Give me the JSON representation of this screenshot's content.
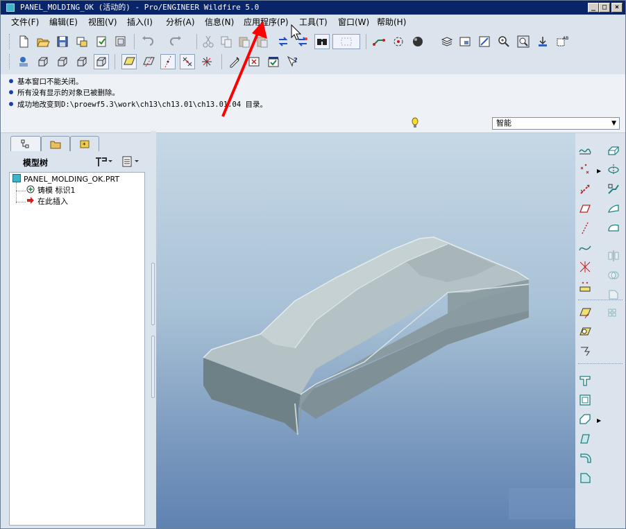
{
  "window": {
    "title": "PANEL_MOLDING_OK (活动的) - Pro/ENGINEER Wildfire 5.0",
    "controls": [
      "_",
      "□",
      "×"
    ]
  },
  "menu": [
    "文件(F)",
    "编辑(E)",
    "视图(V)",
    "插入(I)",
    "分析(A)",
    "信息(N)",
    "应用程序(P)",
    "工具(T)",
    "窗口(W)",
    "帮助(H)"
  ],
  "toolbar_row1": [
    "new-icon",
    "open-icon",
    "save-icon",
    "print-icon",
    "regenerate-icon",
    "send-mail-icon",
    "undo-icon",
    "redo-icon",
    "cut-icon",
    "copy-icon",
    "paste-icon",
    "paste-special-icon",
    "regenerate-manager-icon",
    "find-icon",
    "select-box-icon",
    "datum-display-icon",
    "spin-center-icon",
    "appearance-icon",
    "layers-icon",
    "view-manager-icon",
    "repaint-icon",
    "zoom-in-icon",
    "zoom-fit-icon",
    "reorient-icon",
    "saved-views-icon"
  ],
  "toolbar_row2": [
    "model-display-icon",
    "wireframe-icon",
    "hidden-line-icon",
    "no-hidden-icon",
    "shading-icon",
    "datum-planes-icon",
    "datum-axes-icon",
    "datum-points-icon",
    "coordinate-systems-icon",
    "annotation-icon",
    "close-window-icon",
    "activate-window-icon",
    "context-help-icon"
  ],
  "messages": [
    "基本窗口不能关闭。",
    "所有没有显示的对象已被删除。",
    "成功地改变到D:\\proewf5.3\\work\\ch13\\ch13.01\\ch13.01.04 目录。"
  ],
  "filter": {
    "value": "智能"
  },
  "left_panel": {
    "tabs": [
      "model-tree-tab",
      "folder-browser-tab",
      "favorites-tab"
    ],
    "header": "模型树",
    "tree": [
      {
        "label": "PANEL_MOLDING_OK.PRT",
        "icon": "part-icon"
      },
      {
        "label": "铸模 标识1",
        "icon": "mold-feature-icon"
      },
      {
        "label": "在此插入",
        "icon": "insert-here-arrow-icon"
      }
    ]
  },
  "right_toolbar_col1": [
    "sketched-curve-icon",
    "datum-point-icon",
    "datum-axis-icon",
    "datum-plane-icon",
    "sketch-line-icon",
    "curve-icon",
    "datum-point-offset-icon",
    "datum-csys-icon",
    "refine-icon",
    "layer-filter-icon",
    "hole-icon",
    "shell-icon",
    "draft-icon",
    "round-icon",
    "chamfer-icon",
    "rib-icon"
  ],
  "right_toolbar_col2": [
    "extrude-icon",
    "revolve-icon",
    "sweep-icon",
    "blend-icon",
    "boundary-icon",
    "mirror-icon",
    "merge-icon",
    "trim-icon",
    "pattern-icon"
  ],
  "colors": {
    "title_bar": "#0a246a",
    "viewport_top": "#c6d8e6",
    "viewport_bottom": "#5f82b2",
    "part": "#a9b6b9",
    "annotation_arrow": "#ff0000"
  }
}
